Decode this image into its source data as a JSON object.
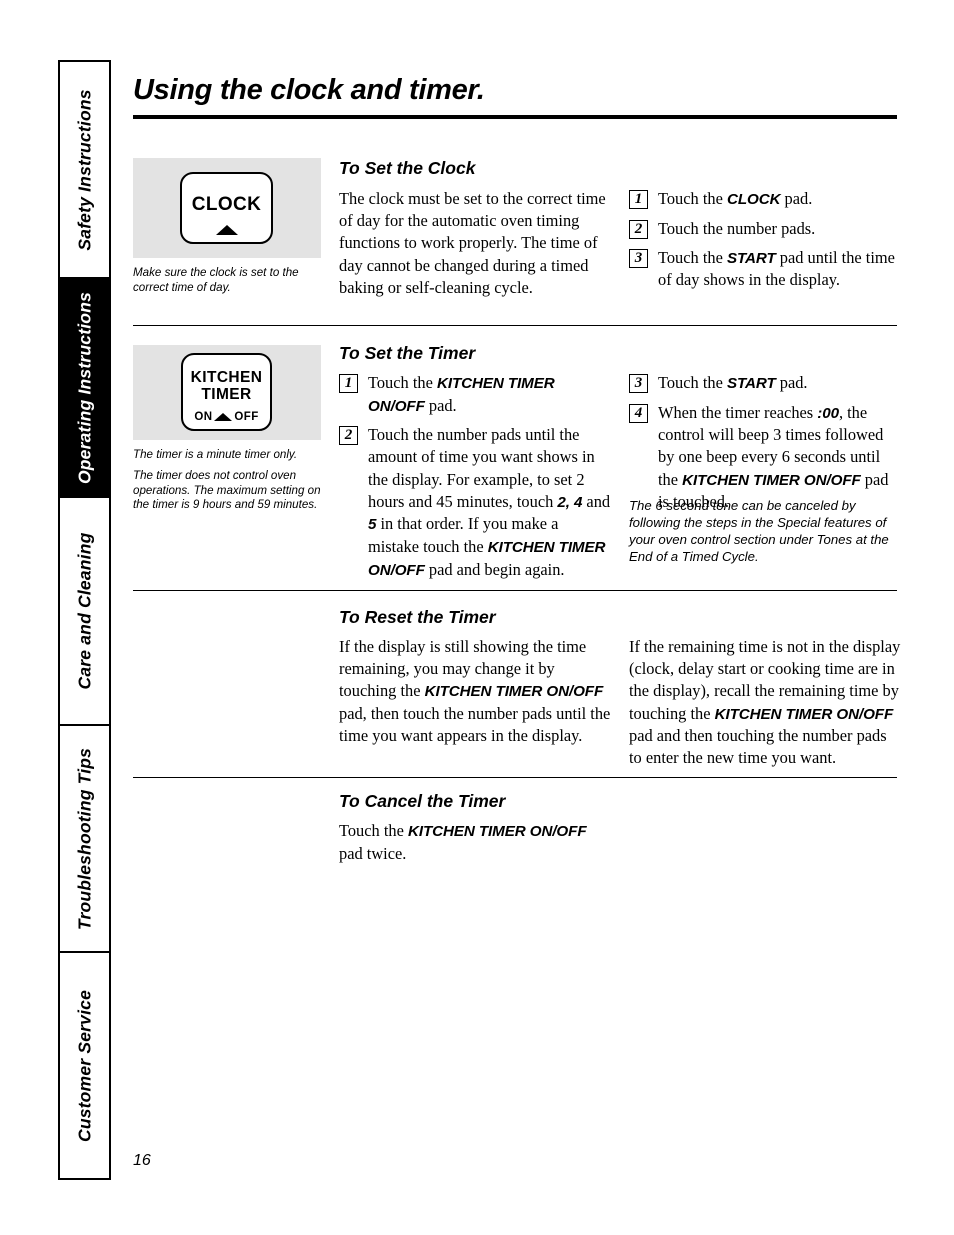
{
  "page": {
    "title": "Using the clock and timer.",
    "number": "16"
  },
  "sidebar": {
    "tabs": [
      {
        "label": "Safety Instructions",
        "active": false
      },
      {
        "label": "Operating Instructions",
        "active": true
      },
      {
        "label": "Care and Cleaning",
        "active": false
      },
      {
        "label": "Troubleshooting Tips",
        "active": false
      },
      {
        "label": "Customer Service",
        "active": false
      }
    ]
  },
  "illustrations": {
    "clock_pad": {
      "label": "CLOCK",
      "caption": "Make sure the clock is set to the correct time of day."
    },
    "timer_pad": {
      "label_line1": "KITCHEN",
      "label_line2": "TIMER",
      "on_label": "ON",
      "off_label": "OFF",
      "caption_1": "The timer is a minute timer only.",
      "caption_2": "The timer does not control oven operations. The maximum setting on the timer is 9 hours and 59 minutes."
    }
  },
  "sections": {
    "set_clock": {
      "heading": "To Set the Clock",
      "body": "The clock must be set to the correct time of day for the automatic oven timing functions to work properly. The time of day cannot be changed during a timed baking or self-cleaning cycle.",
      "steps": [
        {
          "num": "1",
          "text_pre": "Touch the ",
          "pad": "CLOCK",
          "text_post": " pad."
        },
        {
          "num": "2",
          "text_pre": "Touch the number pads.",
          "pad": "",
          "text_post": ""
        },
        {
          "num": "3",
          "text_pre": "Touch the ",
          "pad": "START",
          "text_post": " pad until the time of day shows in the display."
        }
      ]
    },
    "set_timer": {
      "heading": "To Set the Timer",
      "steps_left": [
        {
          "num": "1",
          "text_pre": "Touch the ",
          "pad": "KITCHEN TIMER ON/OFF",
          "text_post": " pad."
        },
        {
          "num": "2",
          "text_pre": "Touch the number pads until the amount of time you want shows in the display. For example, to set 2 hours and 45 minutes, touch ",
          "pad": "2, 4",
          "text_mid": " and ",
          "pad2": "5",
          "text_post": " in that order. If you make a mistake touch the ",
          "pad3": "KITCHEN TIMER ON/OFF",
          "text_end": " pad and begin again."
        }
      ],
      "steps_right": [
        {
          "num": "3",
          "text_pre": "Touch the ",
          "pad": "START",
          "text_post": " pad."
        },
        {
          "num": "4",
          "text_pre": "When the timer reaches ",
          "pad": ":00",
          "text_mid": ", the control will beep 3 times followed by one beep every 6 seconds until the ",
          "pad2": "KITCHEN TIMER ON/OFF",
          "text_post": " pad is touched."
        }
      ],
      "note": "The 6 second tone can be canceled by following the steps in the Special features of your oven control section under Tones at the End of a Timed Cycle."
    },
    "reset_timer": {
      "heading": "To Reset the Timer",
      "left_pre": "If the display is still showing the time remaining, you may change it by touching the ",
      "left_pad": "KITCHEN TIMER ON/OFF",
      "left_post": " pad, then touch the number pads until the time you want appears in the display.",
      "right_pre": "If the remaining time is not in the display (clock, delay start or cooking time are in the display), recall the remaining time by touching the ",
      "right_pad": "KITCHEN TIMER ON/OFF",
      "right_post": " pad and then touching the number pads to enter the new time you want."
    },
    "cancel_timer": {
      "heading": "To Cancel the Timer",
      "text_pre": "Touch the ",
      "pad": "KITCHEN TIMER ON/OFF",
      "text_post": " pad twice."
    }
  }
}
